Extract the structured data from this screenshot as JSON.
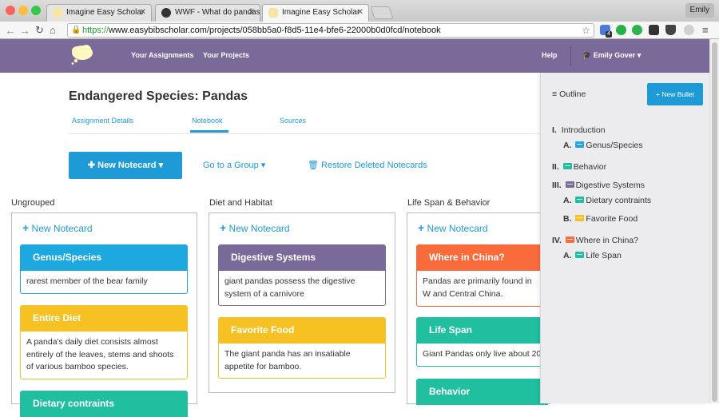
{
  "browser": {
    "tabs": [
      {
        "title": "Imagine Easy Scholar",
        "active": false
      },
      {
        "title": "WWF - What do pandas e…",
        "active": false
      },
      {
        "title": "Imagine Easy Scholar",
        "active": true
      }
    ],
    "profile_name": "Emily",
    "url_scheme": "https://",
    "url_rest": "www.easybibscholar.com/projects/058bb5a0-f8d5-11e4-bfe6-22000b0d0fcd/notebook",
    "ext_badge": "4"
  },
  "app_nav": {
    "your_assignments": "Your Assignments",
    "your_projects": "Your Projects",
    "help": "Help",
    "user": "Emily Gover"
  },
  "page": {
    "title": "Endangered Species: Pandas",
    "tabs": [
      "Assignment Details",
      "Notebook",
      "Sources"
    ],
    "active_tab": "Notebook",
    "new_notecard_button": "New Notecard",
    "go_to_group": "Go to a Group",
    "restore_deleted": "Restore Deleted Notecards"
  },
  "columns": [
    {
      "name": "Ungrouped",
      "add_label": "New Notecard",
      "cards": [
        {
          "title": "Genus/Species",
          "body": "rarest member of the bear family",
          "color": "#1ea8e0"
        },
        {
          "title": "Entire Diet",
          "body": "A panda's daily diet consists almost entirely of the leaves, stems and shoots of various bamboo species.",
          "color": "#f6c223"
        },
        {
          "title": "Dietary contraints",
          "body": "",
          "color": "#1fbf9f"
        }
      ]
    },
    {
      "name": "Diet and Habitat",
      "add_label": "New Notecard",
      "cards": [
        {
          "title": "Digestive Systems",
          "body": "giant pandas possess the digestive system of a carnivore",
          "color": "#7a6a9a"
        },
        {
          "title": "Favorite Food",
          "body": "The giant panda has an insatiable appetite for bamboo.",
          "color": "#f6c223"
        }
      ]
    },
    {
      "name": "Life Span & Behavior",
      "add_label": "New Notecard",
      "cards": [
        {
          "title": "Where in China?",
          "body": "Pandas are primarily found in W and Central China.",
          "color": "#fa6b3c"
        },
        {
          "title": "Life Span",
          "body": "Giant Pandas only live about 20",
          "color": "#1fbf9f"
        },
        {
          "title": "Behavior",
          "body": "",
          "color": "#1fbf9f"
        }
      ]
    }
  ],
  "outline": {
    "title": "Outline",
    "new_bullet": "New Bullet",
    "items": [
      {
        "num": "I.",
        "label": "Introduction",
        "icon_color": ""
      },
      {
        "num": "A.",
        "label": "Genus/Species",
        "icon_color": "#1ea8e0"
      },
      {
        "num": "II.",
        "label": "Behavior",
        "icon_color": "#1fbf9f"
      },
      {
        "num": "III.",
        "label": "Digestive Systems",
        "icon_color": "#7a6a9a"
      },
      {
        "num": "A.",
        "label": "Dietary contraints",
        "icon_color": "#1fbf9f"
      },
      {
        "num": "B.",
        "label": "Favorite Food",
        "icon_color": "#f6c223"
      },
      {
        "num": "IV.",
        "label": "Where in China?",
        "icon_color": "#fa6b3c"
      },
      {
        "num": "A.",
        "label": "Life Span",
        "icon_color": "#1fbf9f"
      }
    ]
  },
  "colors": {
    "accent": "#1e9bd7",
    "header": "#7a6a9a"
  }
}
